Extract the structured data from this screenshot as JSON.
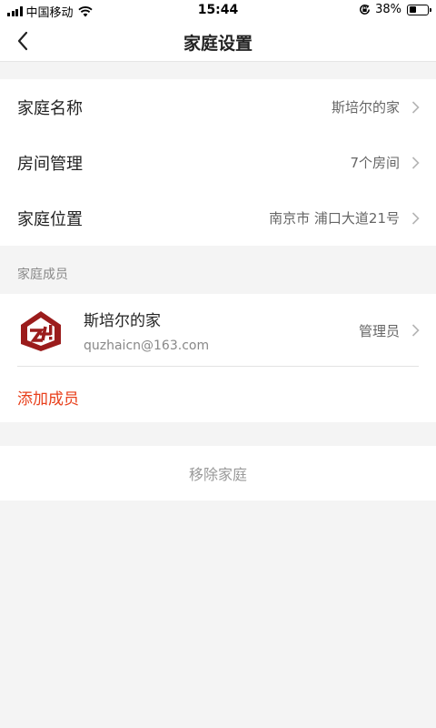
{
  "status_bar": {
    "carrier": "中国移动",
    "time": "15:44",
    "battery": "38%",
    "battery_level": 0.38
  },
  "nav": {
    "title": "家庭设置",
    "back_icon": "chevron-left-icon"
  },
  "settings": [
    {
      "label": "家庭名称",
      "value": "斯培尔的家"
    },
    {
      "label": "房间管理",
      "value": "7个房间"
    },
    {
      "label": "家庭位置",
      "value": "南京市 浦口大道21号"
    }
  ],
  "members": {
    "section_label": "家庭成员",
    "list": [
      {
        "name": "斯培尔的家",
        "email": "quzhaicn@163.com",
        "role": "管理员"
      }
    ],
    "add_label": "添加成员"
  },
  "remove_label": "移除家庭",
  "colors": {
    "accent": "#e8401c",
    "avatar_red": "#9b1c1c",
    "background": "#f4f4f4"
  }
}
